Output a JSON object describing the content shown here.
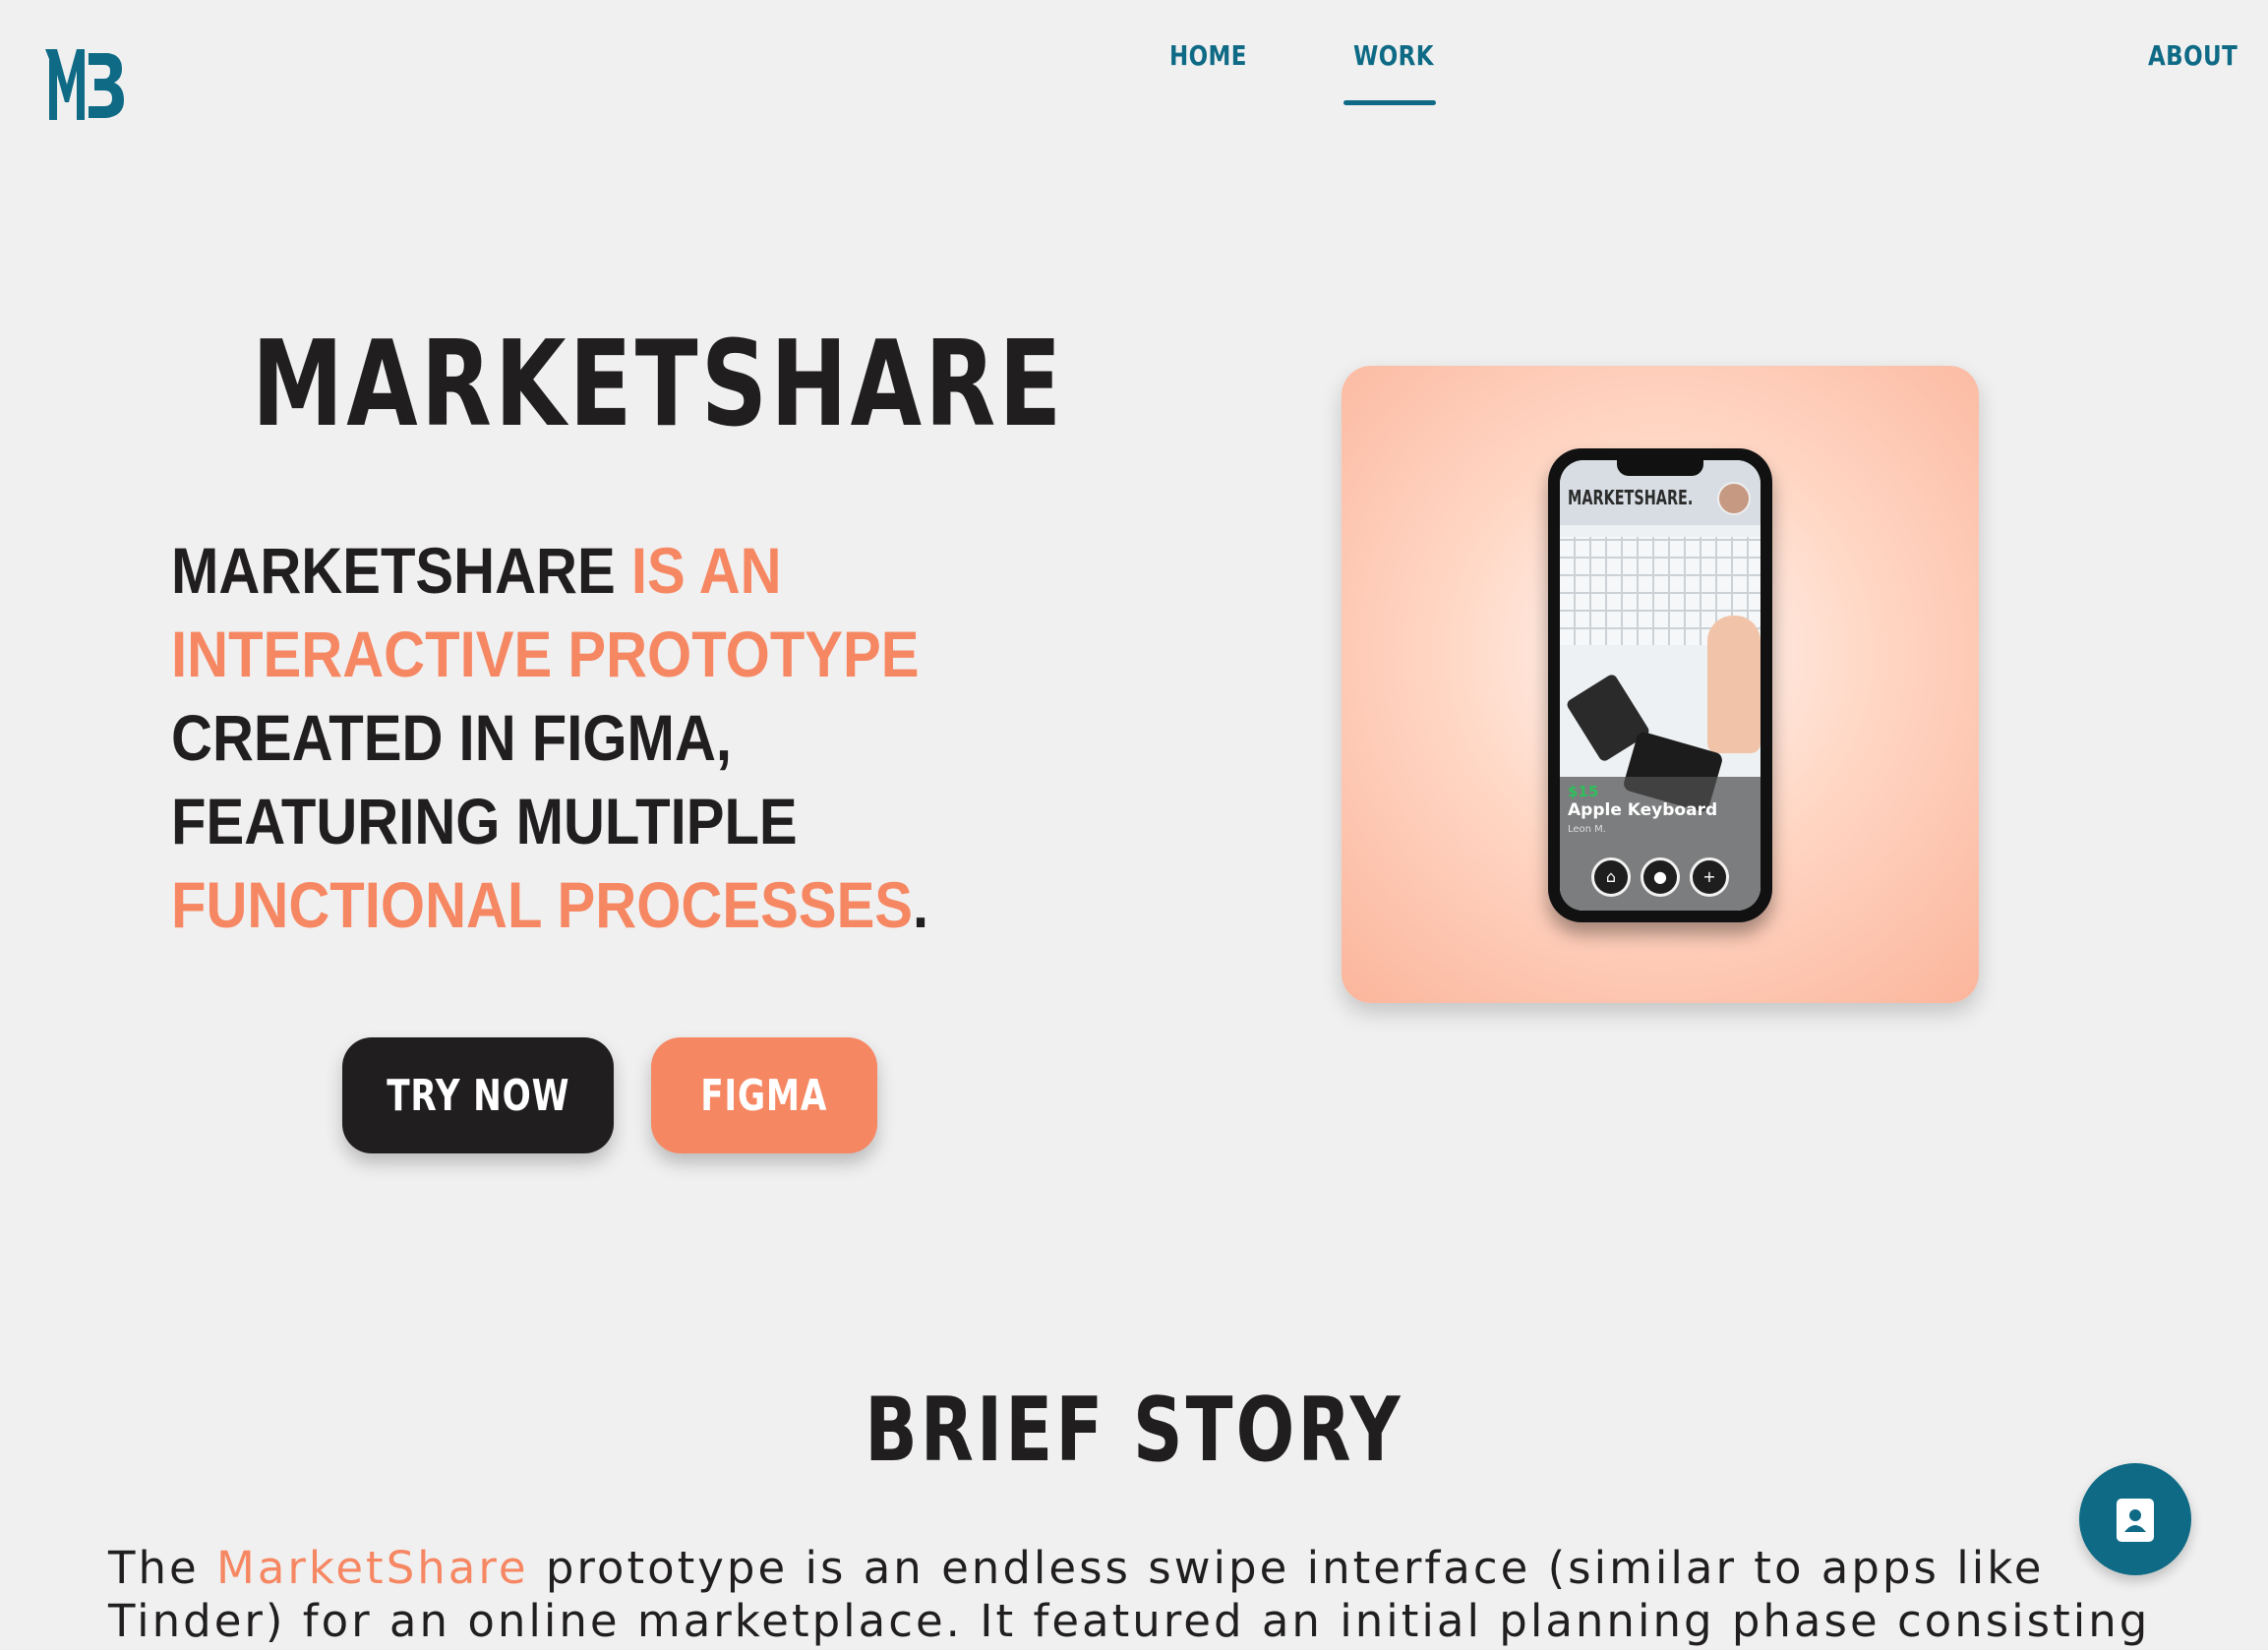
{
  "colors": {
    "accent": "#f68763",
    "brand_teal": "#0e6a85",
    "dark": "#201e1f",
    "background": "#f0f0f0"
  },
  "header": {
    "logo_icon": "mb-monogram-logo",
    "nav": {
      "home": "HOME",
      "work": "WORK",
      "about": "ABOUT",
      "active": "WORK"
    }
  },
  "hero": {
    "title": "MARKETSHARE",
    "description": {
      "part1": "MARKETSHARE ",
      "part2": "IS AN INTERACTIVE PROTOTYPE",
      "part3": " CREATED IN FIGMA, FEATURING MULTIPLE ",
      "part4": "FUNCTIONAL PROCESSES",
      "part5": "."
    },
    "buttons": {
      "try_now": "TRY NOW",
      "figma": "FIGMA"
    },
    "mockup": {
      "brand": "MARKETSHARE.",
      "price": "$15",
      "item_name": "Apple Keyboard",
      "seller": "Leon M.",
      "nav_icons": [
        "home-icon",
        "chat-icon",
        "add-icon"
      ]
    }
  },
  "brief_story": {
    "title": "BRIEF STORY",
    "text_before": "The ",
    "highlight": "MarketShare",
    "text_after": " prototype is an endless swipe interface (similar to apps like Tinder) for an online marketplace. It featured an initial planning phase consisting of user"
  },
  "fab": {
    "icon": "contact-card-icon"
  }
}
